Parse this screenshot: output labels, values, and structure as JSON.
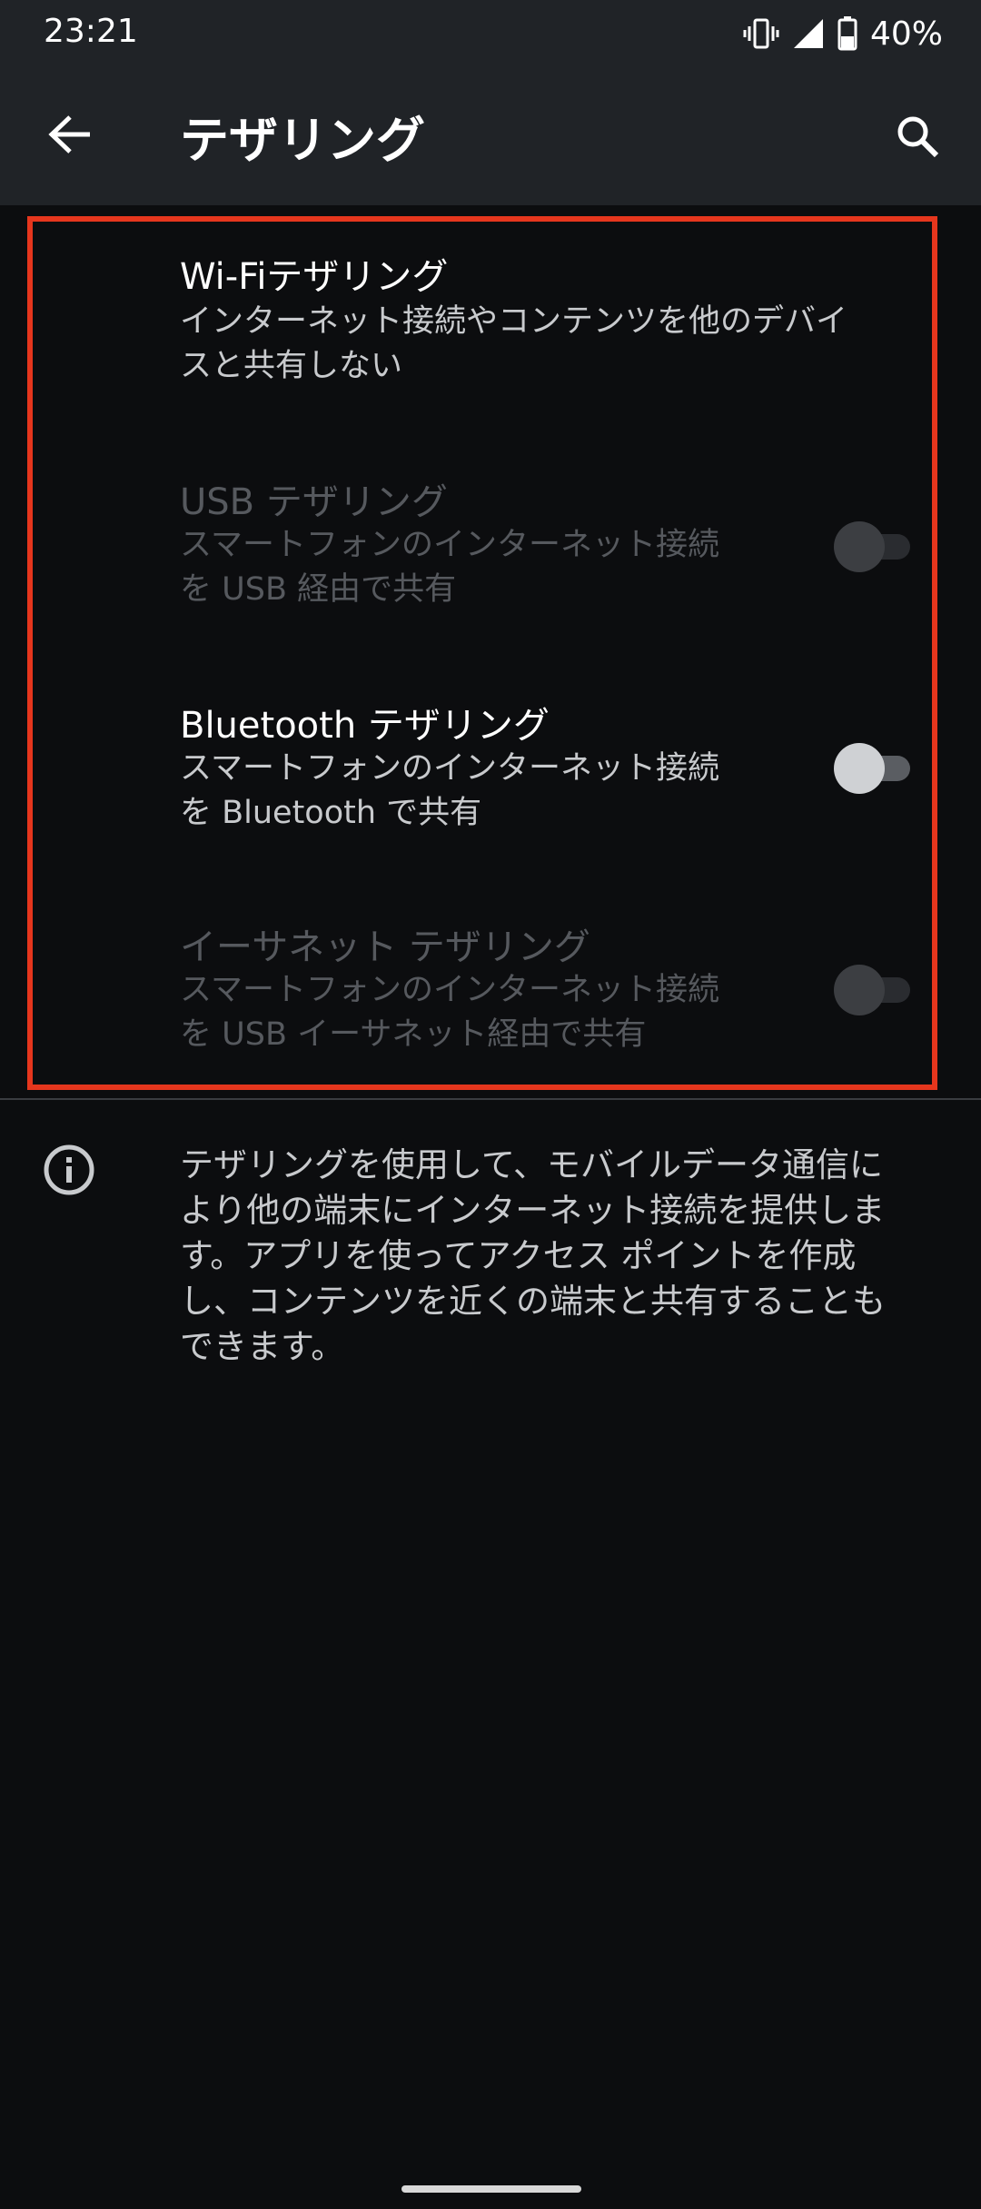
{
  "status_bar": {
    "time": "23:21",
    "battery": "40%",
    "icons": [
      "vibrate-icon",
      "signal-icon",
      "battery-icon"
    ]
  },
  "app_bar": {
    "title": "テザリング",
    "back_icon": "arrow-back-icon",
    "search_icon": "search-icon"
  },
  "settings": [
    {
      "title": "Wi-Fiテザリング",
      "subtitle_lines": [
        "インターネット接続やコンテンツを他のデバイ",
        "スと共有しない"
      ],
      "enabled": true,
      "has_toggle": false
    },
    {
      "title": "USB テザリング",
      "subtitle_lines": [
        "スマートフォンのインターネット接続",
        "を USB 経由で共有"
      ],
      "enabled": false,
      "has_toggle": true,
      "toggle_on": false
    },
    {
      "title": "Bluetooth テザリング",
      "subtitle_lines": [
        "スマートフォンのインターネット接続",
        "を Bluetooth で共有"
      ],
      "enabled": true,
      "has_toggle": true,
      "toggle_on": false
    },
    {
      "title": "イーサネット テザリング",
      "subtitle_lines": [
        "スマートフォンのインターネット接続",
        "を USB イーサネット経由で共有"
      ],
      "enabled": false,
      "has_toggle": true,
      "toggle_on": false
    }
  ],
  "info": {
    "icon": "info-icon",
    "text_lines": [
      "テザリングを使用して、モバイルデータ通信に",
      "より他の端末にインターネット接続を提供しま",
      "す。アプリを使ってアクセス ポイントを作成",
      "し、コンテンツを近くの端末と共有することも",
      "できます。"
    ]
  },
  "colors": {
    "background": "#0c0d0f",
    "app_bar": "#202327",
    "highlight_border": "#e6361d",
    "disabled_text": "#56595e"
  }
}
